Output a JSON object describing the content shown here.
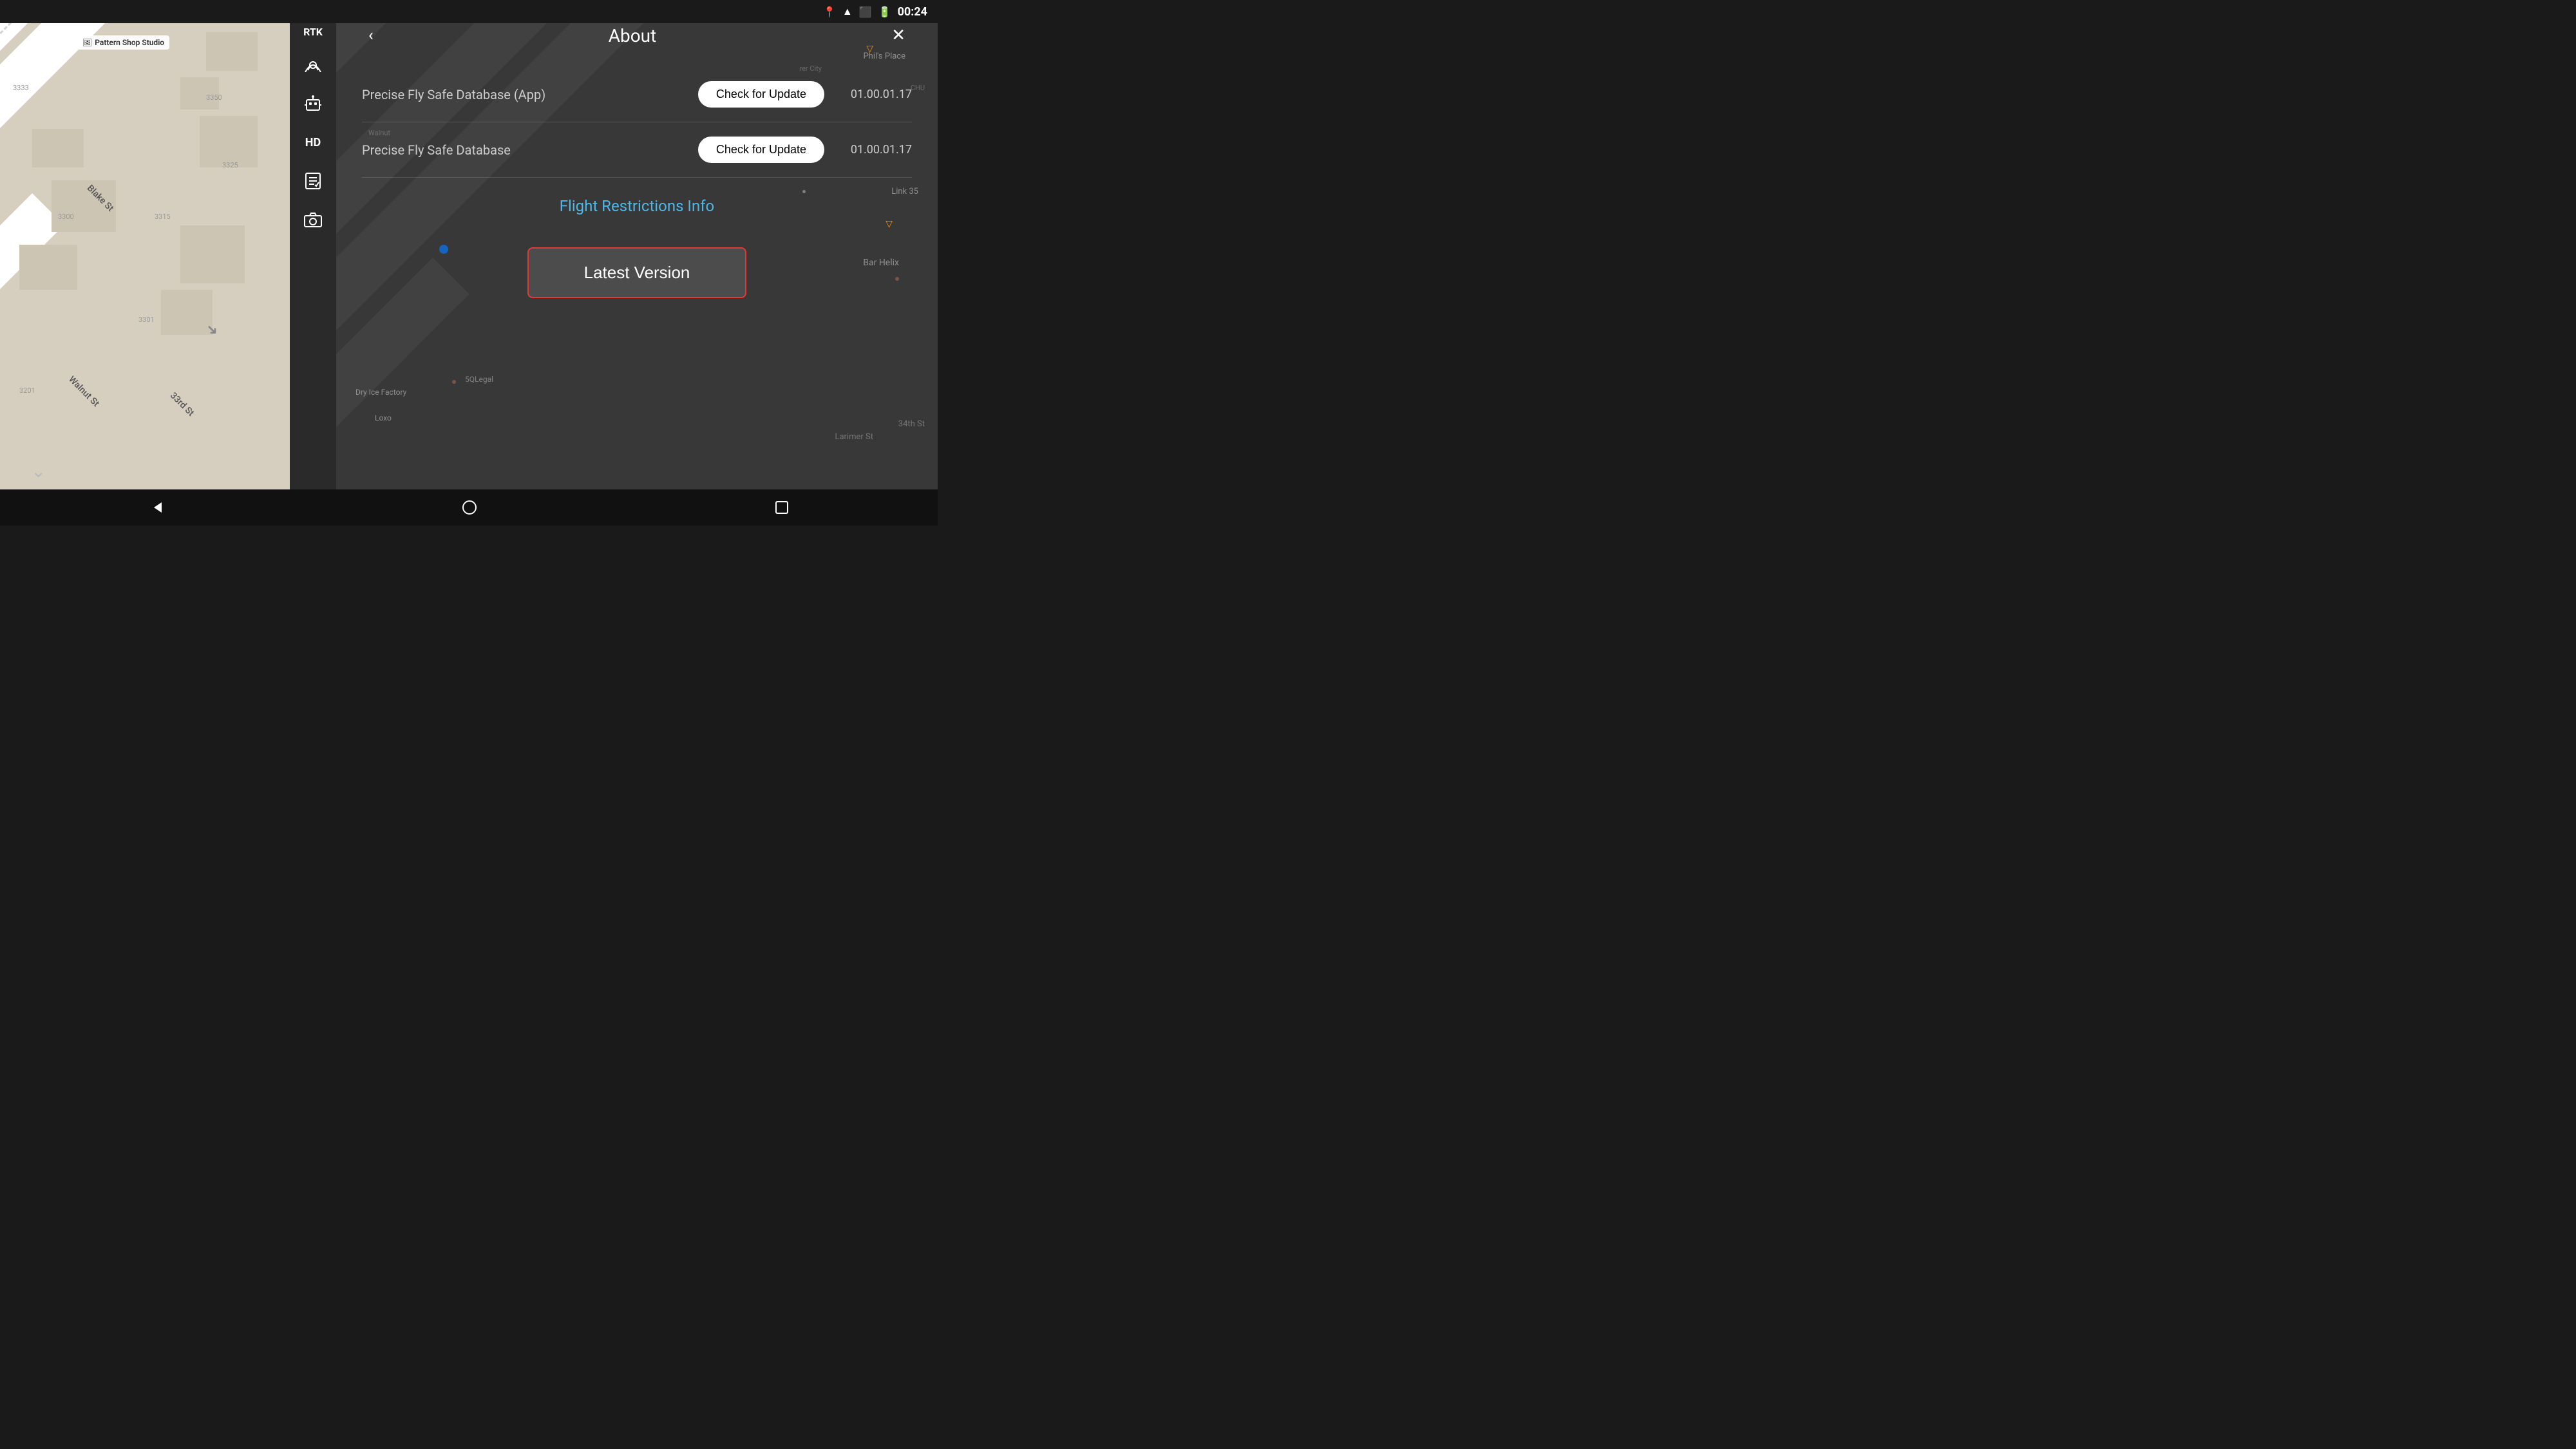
{
  "status_bar": {
    "time": "00:24",
    "icons": [
      "location",
      "wifi",
      "cast",
      "battery"
    ]
  },
  "sidebar": {
    "label": "RTK",
    "icons": [
      {
        "name": "signal-icon",
        "symbol": "●))"
      },
      {
        "name": "robot-icon",
        "symbol": "⚏"
      },
      {
        "name": "hd-label",
        "symbol": "HD"
      },
      {
        "name": "checklist-icon",
        "symbol": "☑"
      },
      {
        "name": "camera-icon",
        "symbol": "📷"
      }
    ],
    "dots": [
      {
        "active": true
      },
      {
        "active": true
      },
      {
        "active": true
      },
      {
        "active": false
      },
      {
        "active": false
      }
    ]
  },
  "panel": {
    "title": "About",
    "back_label": "‹",
    "close_label": "✕",
    "rows": [
      {
        "label": "Precise Fly Safe Database (App)",
        "button_label": "Check for Update",
        "version": "01.00.01.17"
      },
      {
        "label": "Precise Fly Safe Database",
        "button_label": "Check for Update",
        "version": "01.00.01.17"
      }
    ],
    "flight_restrictions_label": "Flight Restrictions Info",
    "latest_version_label": "Latest Version"
  },
  "map": {
    "place_name": "Pattern Shop Studio",
    "street_labels": [
      "Blake St",
      "Walnut St",
      "33rd St",
      "Larimer St",
      "34th St"
    ],
    "numbers": [
      "3333",
      "3350",
      "3325",
      "3315",
      "3300",
      "3301",
      "3201"
    ],
    "dark_labels": [
      "Phil's Place",
      "Bar Helix",
      "Link 35",
      "Dry Ice Factory",
      "Loxo",
      "5QLegal",
      "rer City",
      "CHU"
    ]
  },
  "nav_bar": {
    "back_label": "◁",
    "home_label": "○",
    "recents_label": "□"
  }
}
